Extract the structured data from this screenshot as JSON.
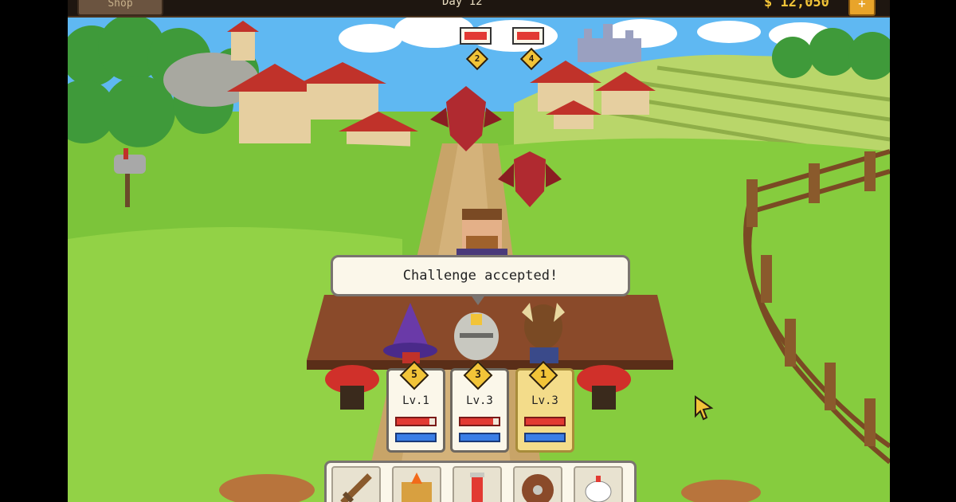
{
  "topbar": {
    "shop_label": "Shop",
    "day_label": "Day 12",
    "gold_amount": "12,050",
    "gold_plus": "+"
  },
  "dialogue": {
    "text": "Challenge accepted!"
  },
  "party": [
    {
      "initiative": "5",
      "level": "Lv.1",
      "hp": 0.85,
      "mp": 1.0,
      "role": "mage",
      "active": false
    },
    {
      "initiative": "3",
      "level": "Lv.3",
      "hp": 0.85,
      "mp": 1.0,
      "role": "knight",
      "active": false
    },
    {
      "initiative": "1",
      "level": "Lv.3",
      "hp": 1.0,
      "mp": 1.0,
      "role": "warrior",
      "active": true
    }
  ],
  "enemies": [
    {
      "initiative": "2",
      "hp": 1.0,
      "name_icon": "bat-monster"
    },
    {
      "initiative": "4",
      "hp": 1.0,
      "name_icon": "bat-monster"
    }
  ],
  "toolbar": {
    "items": [
      "sword-icon",
      "spellbook-icon",
      "potion-icon",
      "shield-icon",
      "chicken-icon"
    ]
  },
  "colors": {
    "grass": "#7cc43a",
    "path": "#c8a468",
    "table": "#8a4a2a",
    "hp": "#e23a32",
    "mp": "#3a7ee6",
    "gold": "#f2c438"
  }
}
